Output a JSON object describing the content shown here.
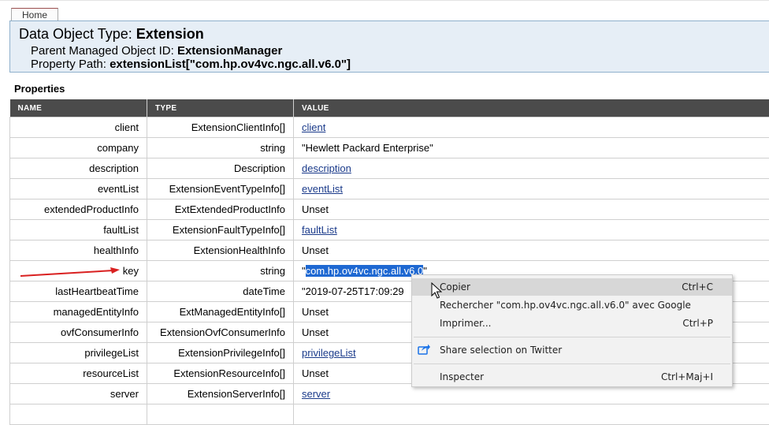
{
  "nav": {
    "home_tab": "Home"
  },
  "header": {
    "title_prefix": "Data Object Type:",
    "title_value": "Extension",
    "parent_label": "Parent Managed Object ID:",
    "parent_value": "ExtensionManager",
    "path_label": "Property Path:",
    "path_value": "extensionList[\"com.hp.ov4vc.ngc.all.v6.0\"]"
  },
  "properties": {
    "label": "Properties",
    "columns": [
      "NAME",
      "TYPE",
      "VALUE"
    ],
    "rows": [
      {
        "name": "client",
        "type": "ExtensionClientInfo[]",
        "value": "client",
        "link": true
      },
      {
        "name": "company",
        "type": "string",
        "value": "\"Hewlett Packard Enterprise\"",
        "link": false
      },
      {
        "name": "description",
        "type": "Description",
        "value": "description",
        "link": true
      },
      {
        "name": "eventList",
        "type": "ExtensionEventTypeInfo[]",
        "value": "eventList",
        "link": true
      },
      {
        "name": "extendedProductInfo",
        "type": "ExtExtendedProductInfo",
        "value": "Unset",
        "link": false
      },
      {
        "name": "faultList",
        "type": "ExtensionFaultTypeInfo[]",
        "value": "faultList",
        "link": true
      },
      {
        "name": "healthInfo",
        "type": "ExtensionHealthInfo",
        "value": "Unset",
        "link": false
      },
      {
        "name": "key",
        "type": "string",
        "value_prefix": "\"",
        "value_selected": "com.hp.ov4vc.ngc.all.v6.0",
        "value_suffix": "\"",
        "selected": true
      },
      {
        "name": "lastHeartbeatTime",
        "type": "dateTime",
        "value": "\"2019-07-25T17:09:29",
        "link": false
      },
      {
        "name": "managedEntityInfo",
        "type": "ExtManagedEntityInfo[]",
        "value": "Unset",
        "link": false
      },
      {
        "name": "ovfConsumerInfo",
        "type": "ExtensionOvfConsumerInfo",
        "value": "Unset",
        "link": false
      },
      {
        "name": "privilegeList",
        "type": "ExtensionPrivilegeInfo[]",
        "value": "privilegeList",
        "link": true
      },
      {
        "name": "resourceList",
        "type": "ExtensionResourceInfo[]",
        "value": "Unset",
        "link": false
      },
      {
        "name": "server",
        "type": "ExtensionServerInfo[]",
        "value": "server",
        "link": true
      },
      {
        "name": "",
        "type": "",
        "value": "",
        "link": false
      }
    ]
  },
  "context_menu": {
    "copy": {
      "label": "Copier",
      "shortcut": "Ctrl+C"
    },
    "search": {
      "label": "Rechercher \"com.hp.ov4vc.ngc.all.v6.0\" avec Google"
    },
    "print": {
      "label": "Imprimer...",
      "shortcut": "Ctrl+P"
    },
    "share": {
      "label": "Share selection on Twitter",
      "icon": "share-icon"
    },
    "inspect": {
      "label": "Inspecter",
      "shortcut": "Ctrl+Maj+I"
    }
  },
  "colors": {
    "header_bg": "#e6eef6",
    "table_header_bg": "#4b4b4b",
    "selection": "#1e68d2",
    "annotation_arrow": "#d92020"
  }
}
